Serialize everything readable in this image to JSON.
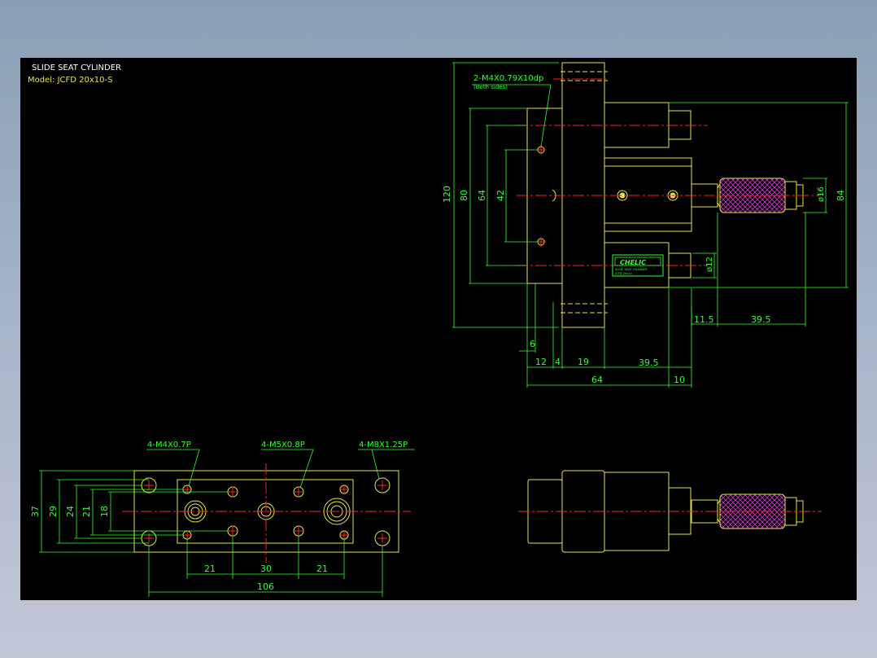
{
  "title": {
    "line1": "SLIDE SEAT CYLINDER",
    "line2": "Model: JCFD 20x10-S"
  },
  "colors": {
    "background": "#000000",
    "outline": "#e6e64c",
    "dimension": "#33ff33",
    "centerline": "#ff2222",
    "hatch": "#cc33cc",
    "label_bg": "#33ff33"
  },
  "callouts": {
    "side_thread": "2-M4X0.79X10dp",
    "side_thread_note": "(Both sides)",
    "m4": "4-M4X0.7P",
    "m5": "4-M5X0.8P",
    "m8": "4-M8X1.25P"
  },
  "label_plate": {
    "brand": "CHELIC",
    "line1": "SLIDE SEAT CYLINDER",
    "line2": "JCFD 20x10"
  },
  "dims_side": {
    "h120": "120",
    "h80": "80",
    "h64": "64",
    "h42": "42",
    "h84": "84",
    "d16": "ø16",
    "d12": "ø12",
    "w6": "6",
    "w12": "12",
    "w4": "4",
    "w19": "19",
    "w39_5": "39.5",
    "w64": "64",
    "w10": "10",
    "w11_5": "11.5",
    "w39_5b": "39.5"
  },
  "dims_bottom": {
    "h37": "37",
    "h29": "29",
    "h24": "24",
    "h21": "21",
    "h18": "18",
    "w21a": "21",
    "w30": "30",
    "w21b": "21",
    "w106": "106"
  }
}
